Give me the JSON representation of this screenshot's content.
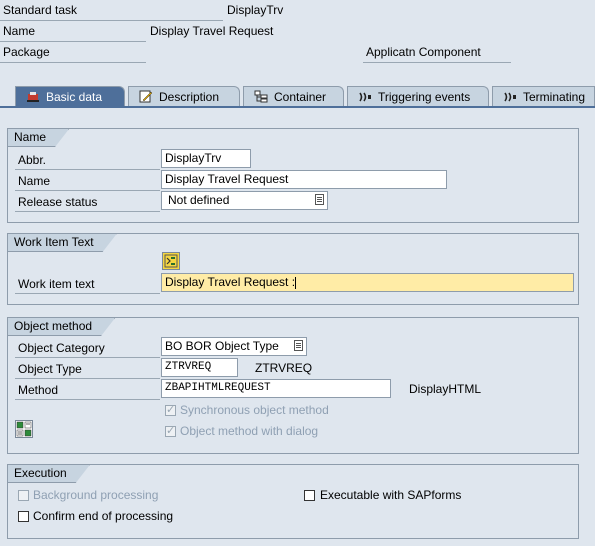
{
  "header": {
    "standard_task_label": "Standard task",
    "standard_task_value": "DisplayTrv",
    "name_label": "Name",
    "name_value": "Display Travel Request",
    "package_label": "Package",
    "app_component_label": "Applicatn Component"
  },
  "tabs": [
    {
      "label": "Basic data",
      "icon": "basic-data-icon",
      "active": true
    },
    {
      "label": "Description",
      "icon": "description-icon",
      "active": false
    },
    {
      "label": "Container",
      "icon": "container-icon",
      "active": false
    },
    {
      "label": "Triggering events",
      "icon": "events-icon",
      "active": false
    },
    {
      "label": "Terminating",
      "icon": "events-icon",
      "active": false
    }
  ],
  "name_group": {
    "title": "Name",
    "abbr_label": "Abbr.",
    "abbr_value": "DisplayTrv",
    "name_label": "Name",
    "name_value": "Display Travel Request",
    "release_label": "Release status",
    "release_value": "Not defined"
  },
  "work_item_group": {
    "title": "Work Item Text",
    "text_label": "Work item text",
    "text_value": "Display Travel Request :"
  },
  "object_method_group": {
    "title": "Object method",
    "category_label": "Object Category",
    "category_value": "BO BOR Object Type",
    "type_label": "Object Type",
    "type_value": "ZTRVREQ",
    "type_desc": "ZTRVREQ",
    "method_label": "Method",
    "method_value": "ZBAPIHTMLREQUEST",
    "method_desc": "DisplayHTML",
    "sync_label": "Synchronous object method",
    "dialog_label": "Object method with dialog"
  },
  "execution_group": {
    "title": "Execution",
    "background_label": "Background processing",
    "sapforms_label": "Executable with SAPforms",
    "confirm_label": "Confirm end of processing"
  },
  "colors": {
    "tab_active": "#4e6f9a",
    "tab_inactive": "#c7d4e0",
    "background": "#dfe6ee",
    "highlight_input": "#ffeca6"
  }
}
